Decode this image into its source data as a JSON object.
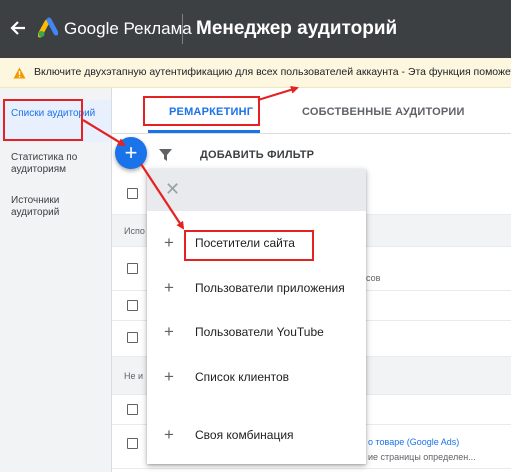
{
  "header": {
    "brand": "Google Реклама",
    "title": "Менеджер аудиторий",
    "back_icon": "arrow-back-icon",
    "logo_icon": "google-ads-logo"
  },
  "banner": {
    "text": "Включите двухэтапную аутентификацию для всех пользователей аккаунта - Эта функция поможет",
    "icon": "warning-icon"
  },
  "sidebar": {
    "items": [
      {
        "label": "Списки аудиторий",
        "active": true
      },
      {
        "label": "Статистика по аудиториям",
        "active": false
      },
      {
        "label": "Источники аудиторий",
        "active": false
      }
    ]
  },
  "tabs": [
    {
      "label": "РЕМАРКЕТИНГ",
      "active": true
    },
    {
      "label": "СОБСТВЕННЫЕ АУДИТОРИИ",
      "active": false
    }
  ],
  "filterbar": {
    "add_filter": "ДОБАВИТЬ ФИЛЬТР",
    "icon": "filter-icon"
  },
  "fab": {
    "label": "+"
  },
  "table": {
    "section1": "Испо",
    "section2": "Не и",
    "row_fragments": {
      "r2": "сов",
      "r7": "о товаре (Google Ads)",
      "r7b": "ие страницы определен..."
    }
  },
  "menu": {
    "close_icon": "close-icon",
    "items": [
      {
        "label": "Посетители сайта"
      },
      {
        "label": "Пользователи приложения"
      },
      {
        "label": "Пользователи YouTube"
      },
      {
        "label": "Список клиентов"
      },
      {
        "label": "Своя комбинация"
      }
    ]
  },
  "colors": {
    "accent": "#1a73e8",
    "header_bg": "#3c4043",
    "annotation": "#e52222",
    "banner_bg": "#fef7e0"
  }
}
